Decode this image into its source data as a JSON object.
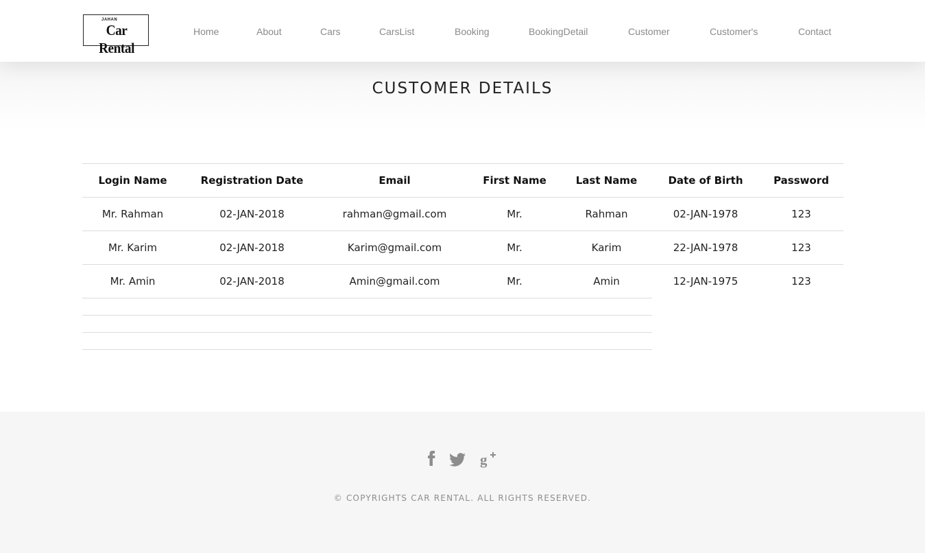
{
  "brand": {
    "logo_small": "JAHAN",
    "logo_main": "Car Rental"
  },
  "nav": {
    "items": [
      {
        "label": "Home"
      },
      {
        "label": "About"
      },
      {
        "label": "Cars"
      },
      {
        "label": "CarsList"
      },
      {
        "label": "Booking"
      },
      {
        "label": "BookingDetail"
      },
      {
        "label": "Customer"
      },
      {
        "label": "Customer's"
      },
      {
        "label": "Contact"
      }
    ]
  },
  "page": {
    "title": "CUSTOMER DETAILS"
  },
  "table": {
    "headers": [
      "Login Name",
      "Registration Date",
      "Email",
      "First Name",
      "Last Name",
      "Date of Birth",
      "Password"
    ],
    "rows": [
      [
        "Mr. Rahman",
        "02-JAN-2018",
        "rahman@gmail.com",
        "Mr.",
        "Rahman",
        "02-JAN-1978",
        "123"
      ],
      [
        "Mr. Karim",
        "02-JAN-2018",
        "Karim@gmail.com",
        "Mr.",
        "Karim",
        "22-JAN-1978",
        "123"
      ],
      [
        "Mr. Amin",
        "02-JAN-2018",
        "Amin@gmail.com",
        "Mr.",
        "Amin",
        "12-JAN-1975",
        "123"
      ]
    ]
  },
  "footer": {
    "social_icons": [
      "facebook-icon",
      "twitter-icon",
      "google-plus-icon"
    ],
    "copyright": "© COPYRIGHTS CAR RENTAL. ALL RIGHTS RESERVED."
  },
  "colors": {
    "nav_text": "#8a8a8a",
    "footer_bg": "#f6f6f6",
    "icon_gray": "#8d8d8d"
  }
}
